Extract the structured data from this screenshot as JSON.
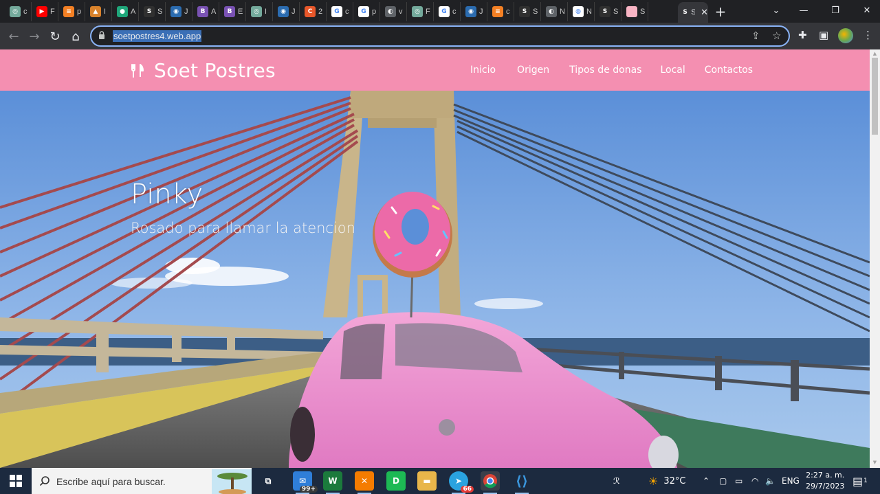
{
  "browser": {
    "tabs": [
      {
        "title": "c",
        "icon": "chatgpt-icon",
        "color": "#74aa9c",
        "glyph": "◎"
      },
      {
        "title": "F",
        "icon": "youtube-icon",
        "color": "#ff0000",
        "glyph": "▶"
      },
      {
        "title": "p",
        "icon": "stackoverflow-icon",
        "color": "#f48024",
        "glyph": "≡"
      },
      {
        "title": "I",
        "icon": "mountain-icon",
        "color": "#d9822b",
        "glyph": "▲"
      },
      {
        "title": "A",
        "icon": "globe-icon",
        "color": "#1fa67a",
        "glyph": "●"
      },
      {
        "title": "S",
        "icon": "soet-icon",
        "color": "#303030",
        "glyph": "S"
      },
      {
        "title": "J",
        "icon": "devtools-icon",
        "color": "#2b6cb0",
        "glyph": "◉"
      },
      {
        "title": "A",
        "icon": "bootstrap-icon",
        "color": "#7952b3",
        "glyph": "B"
      },
      {
        "title": "E",
        "icon": "bootstrap-icon",
        "color": "#7952b3",
        "glyph": "B"
      },
      {
        "title": "I",
        "icon": "chatgpt-icon",
        "color": "#74aa9c",
        "glyph": "◎"
      },
      {
        "title": "J",
        "icon": "devtools-icon",
        "color": "#2b6cb0",
        "glyph": "◉"
      },
      {
        "title": "2",
        "icon": "c-icon",
        "color": "#e8572a",
        "glyph": "C"
      },
      {
        "title": "c",
        "icon": "google-icon",
        "color": "#ffffff",
        "glyph": "G"
      },
      {
        "title": "p",
        "icon": "google-icon",
        "color": "#ffffff",
        "glyph": "G"
      },
      {
        "title": "v",
        "icon": "globe-icon",
        "color": "#5f6368",
        "glyph": "◐"
      },
      {
        "title": "F",
        "icon": "chatgpt-icon",
        "color": "#74aa9c",
        "glyph": "◎"
      },
      {
        "title": "c",
        "icon": "google-icon",
        "color": "#ffffff",
        "glyph": "G"
      },
      {
        "title": "J",
        "icon": "devtools-icon",
        "color": "#2b6cb0",
        "glyph": "◉"
      },
      {
        "title": "c",
        "icon": "stackoverflow-icon",
        "color": "#f48024",
        "glyph": "≡"
      },
      {
        "title": "S",
        "icon": "soet-icon",
        "color": "#303030",
        "glyph": "S"
      },
      {
        "title": "N",
        "icon": "globe-icon",
        "color": "#5f6368",
        "glyph": "◐"
      },
      {
        "title": "N",
        "icon": "chrome-icon",
        "color": "#ffffff",
        "glyph": "◍"
      },
      {
        "title": "S",
        "icon": "soet-icon",
        "color": "#303030",
        "glyph": "S"
      },
      {
        "title": "S",
        "icon": "pink-square-icon",
        "color": "#f8b4c4",
        "glyph": " "
      },
      {
        "title": "S",
        "icon": "soet-icon",
        "color": "#35363a",
        "glyph": "S",
        "active": true
      }
    ],
    "address": "soetpostres4.web.app"
  },
  "site": {
    "brand": "Soet Postres",
    "menu": [
      "Inicio",
      "Origen",
      "Tipos de donas",
      "Local",
      "Contactos"
    ],
    "hero_title": "Pinky",
    "hero_subtitle": "Rosado para llamar la atencion"
  },
  "taskbar": {
    "search_placeholder": "Escribe aquí para buscar.",
    "mail_badge": "99+",
    "telegram_badge": "66",
    "temperature": "32°C",
    "language": "ENG",
    "time": "2:27 a. m.",
    "date": "29/7/2023",
    "notification_count": "1"
  },
  "colors": {
    "site_nav": "#f48fb1",
    "focus_ring": "#8ab4f8",
    "taskbar": "#1c2a3f"
  }
}
